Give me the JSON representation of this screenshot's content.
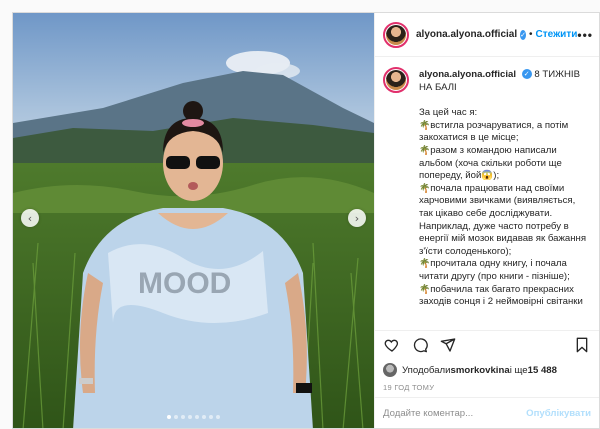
{
  "post": {
    "username": "alyona.alyona.official",
    "follow_label": "Стежити",
    "more_label": "•••",
    "caption": {
      "title": "8 ТИЖНІВ НА БАЛІ",
      "lines": [
        "За цей час я:",
        "встигла розчаруватися, а потім закохатися в це місце;",
        "разом з командою написали альбом (хоча скільки роботи ще попереду, йой😱);",
        "почала працювати над своїми харчовими звичками (виявляється, так цікаво себе досліджувати. Наприклад, дуже часто потребу в енергії мій мозок видавав як бажання з'їсти солоденького);",
        "прочитала одну книгу, і почала читати другу (про книги - пізніше);",
        "побачила так багато прекрасних заходів сонця і 2 неймовірні світанки"
      ]
    },
    "likes": {
      "prefix": "Уподобали ",
      "user": "smorkovkina",
      "middle": " і ще ",
      "count": "15 488"
    },
    "time_ago": "19 ГОД ТОМУ",
    "comment": {
      "placeholder": "Додайте коментар...",
      "publish_label": "Опублікувати"
    }
  },
  "carousel": {
    "prev_icon": "chevron-left-icon",
    "next_icon": "chevron-right-icon",
    "slide_count": 8,
    "active_index": 0
  },
  "icons": {
    "heart": "heart-icon",
    "comment": "comment-icon",
    "share": "share-icon",
    "bookmark": "bookmark-icon",
    "caption_bullet": "tree-emoji-icon"
  },
  "colors": {
    "follow": "#0095f6",
    "publish_disabled": "#b2dffc",
    "verified": "#3897f0",
    "story_ring": "#e1306c"
  }
}
